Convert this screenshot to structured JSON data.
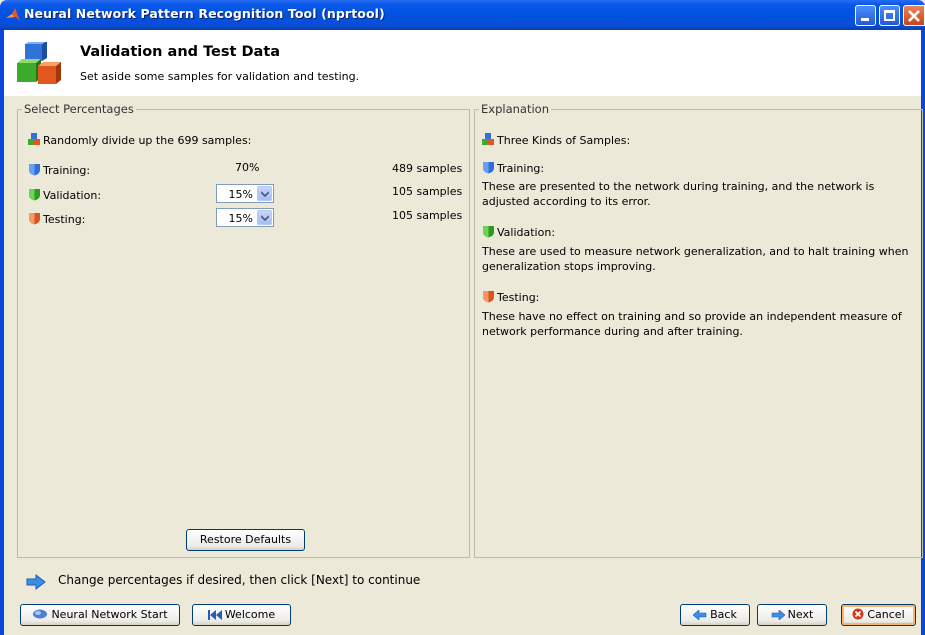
{
  "window": {
    "title": "Neural Network Pattern Recognition Tool (nprtool)"
  },
  "header": {
    "title": "Validation and Test Data",
    "subtitle": "Set aside some samples for validation and testing."
  },
  "left_panel": {
    "legend": "Select Percentages",
    "intro": "Randomly divide up the 699 samples:",
    "rows": [
      {
        "label": "Training:",
        "percent": "70%",
        "samples": "489 samples",
        "color": "#2f6fd8"
      },
      {
        "label": "Validation:",
        "percent": "15%",
        "samples": "105 samples",
        "color": "#2f9a1e"
      },
      {
        "label": "Testing:",
        "percent": "15%",
        "samples": "105 samples",
        "color": "#d8561c"
      }
    ],
    "restore_label": "Restore Defaults"
  },
  "right_panel": {
    "legend": "Explanation",
    "intro": "Three Kinds of Samples:",
    "sections": [
      {
        "title": "Training:",
        "text": "These are presented to the network during training, and the network is adjusted according to its error."
      },
      {
        "title": "Validation:",
        "text": "These are used to measure network generalization, and to halt training when generalization stops improving."
      },
      {
        "title": "Testing:",
        "text": "These have no effect on training and so provide an independent measure of network performance during and after training."
      }
    ]
  },
  "hint": "Change percentages if desired, then click [Next] to continue",
  "buttons": {
    "nn_start": "Neural Network Start",
    "welcome": "Welcome",
    "back": "Back",
    "next": "Next",
    "cancel": "Cancel"
  },
  "icons": {
    "app": "matlab-icon",
    "header": "cubes-icon"
  }
}
